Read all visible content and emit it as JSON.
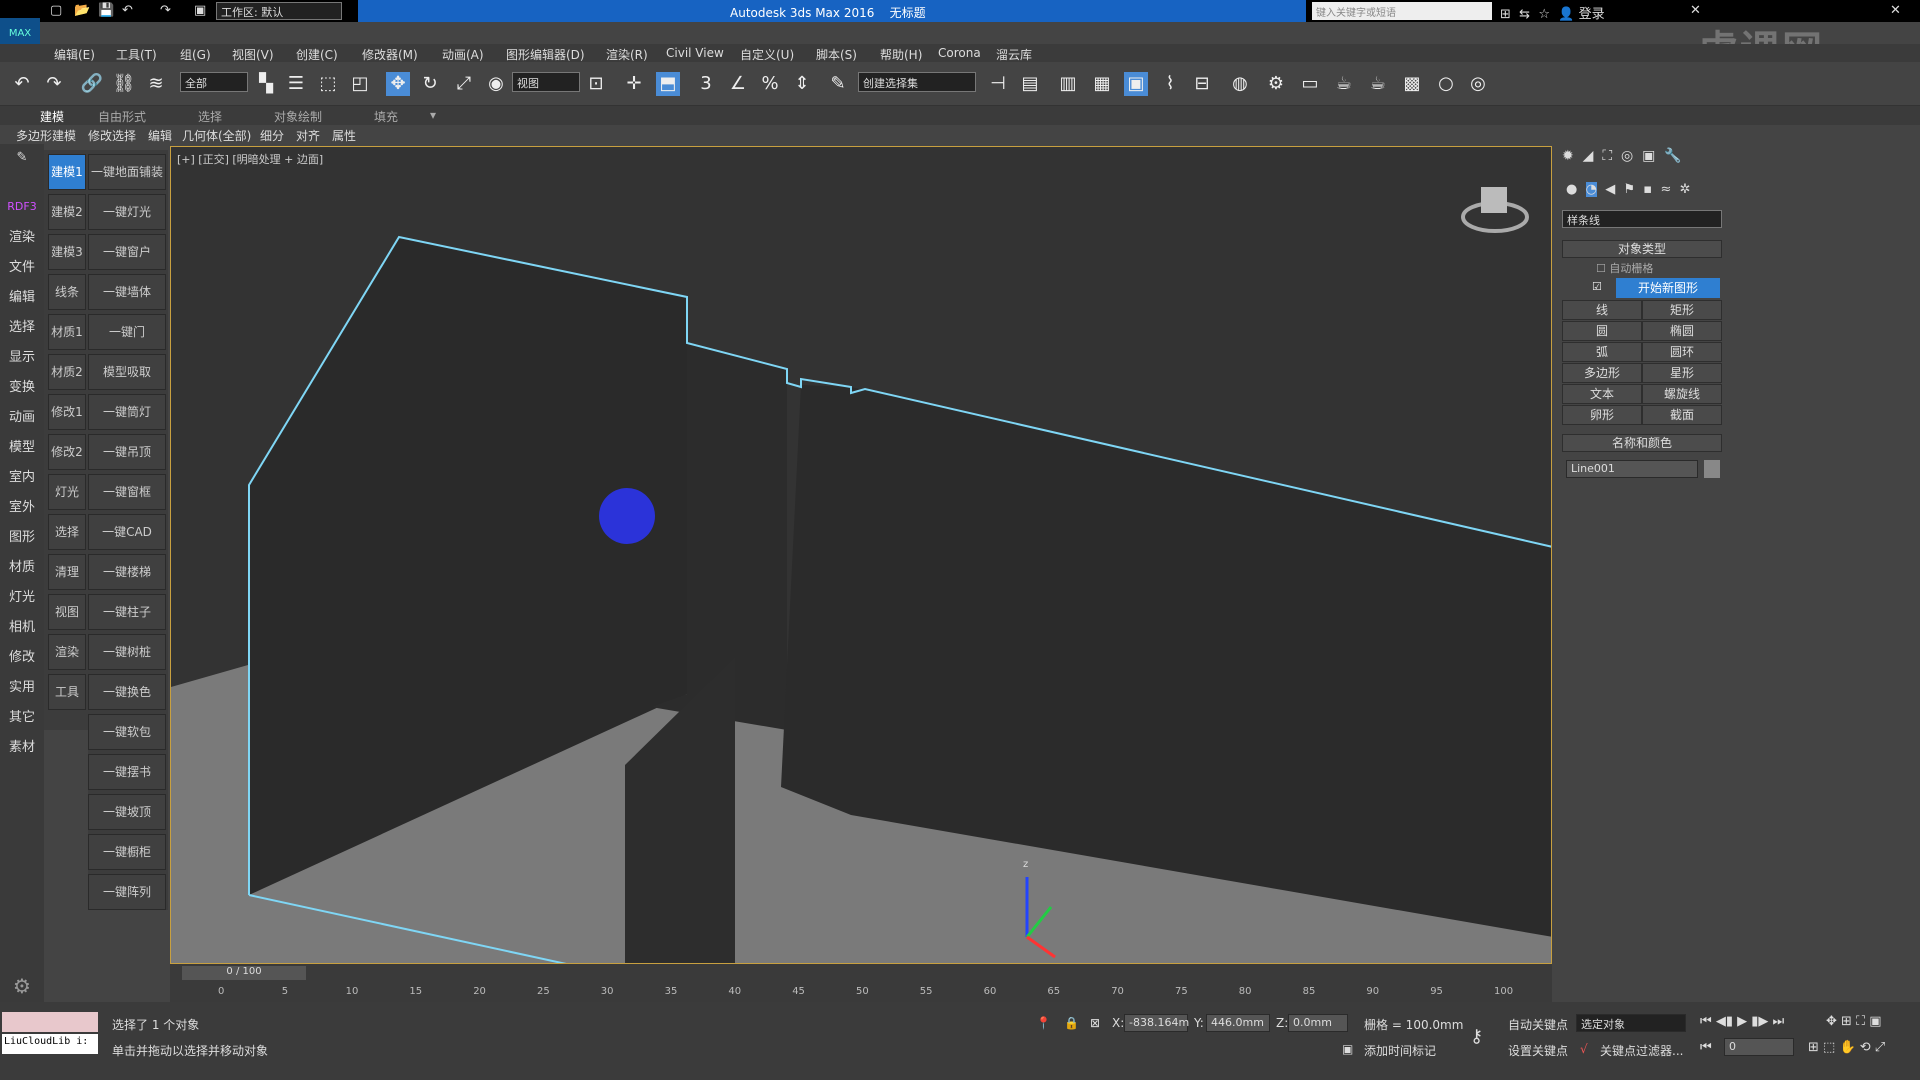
{
  "app": {
    "title": "Autodesk 3ds Max 2016",
    "doc_title": "无标题",
    "logo": "MAX",
    "workspace": "工作区: 默认",
    "search_placeholder": "键入关键字或短语",
    "login": "登录",
    "watermark": "虎课网"
  },
  "menu": [
    "编辑(E)",
    "工具(T)",
    "组(G)",
    "视图(V)",
    "创建(C)",
    "修改器(M)",
    "动画(A)",
    "图形编辑器(D)",
    "渲染(R)",
    "Civil View",
    "自定义(U)",
    "脚本(S)",
    "帮助(H)",
    "Corona",
    "溜云库"
  ],
  "toolbar": {
    "filter": "全部",
    "ref_coord": "视图",
    "selection_set": "创建选择集"
  },
  "ribbon_tabs": [
    "建模",
    "自由形式",
    "选择",
    "对象绘制",
    "填充"
  ],
  "ribbon_sub": [
    "多边形建模",
    "修改选择",
    "编辑",
    "几何体(全部)",
    "细分",
    "对齐",
    "属性"
  ],
  "left_col1": [
    "RDF3",
    "渲染",
    "文件",
    "编辑",
    "选择",
    "显示",
    "变换",
    "动画",
    "模型",
    "室内",
    "室外",
    "图形",
    "材质",
    "灯光",
    "相机",
    "修改",
    "实用",
    "其它",
    "素材"
  ],
  "left_col2": [
    "建模1",
    "建模2",
    "建模3",
    "线条",
    "材质1",
    "材质2",
    "修改1",
    "修改2",
    "灯光",
    "选择",
    "清理",
    "视图",
    "渲染",
    "工具"
  ],
  "left_col3": [
    "一键地面铺装",
    "一键灯光",
    "一键窗户",
    "一键墙体",
    "一键门",
    "模型吸取",
    "一键筒灯",
    "一键吊顶",
    "一键窗框",
    "一键CAD",
    "一键楼梯",
    "一键柱子",
    "一键树桩",
    "一键换色",
    "一键软包",
    "一键摆书",
    "一键坡顶",
    "一键橱柜",
    "一键阵列"
  ],
  "viewport": {
    "label": "[+] [正交] [明暗处理 + 边面]",
    "axis_z": "z"
  },
  "cmd": {
    "dropdown": "样条线",
    "rollout1": "对象类型",
    "auto_grid": "自动栅格",
    "start_new_shape": "开始新图形",
    "shapes": [
      [
        "线",
        "矩形"
      ],
      [
        "圆",
        "椭圆"
      ],
      [
        "弧",
        "圆环"
      ],
      [
        "多边形",
        "星形"
      ],
      [
        "文本",
        "螺旋线"
      ],
      [
        "卵形",
        "截面"
      ]
    ],
    "rollout2": "名称和颜色",
    "name": "Line001"
  },
  "timeline": {
    "frame": "0 / 100",
    "ticks": [
      "0",
      "5",
      "10",
      "15",
      "20",
      "25",
      "30",
      "35",
      "40",
      "45",
      "50",
      "55",
      "60",
      "65",
      "70",
      "75",
      "80",
      "85",
      "90",
      "95",
      "100"
    ]
  },
  "status": {
    "script_box": "LiuCloudLib i:",
    "selected": "选择了 1 个对象",
    "hint": "单击并拖动以选择并移动对象",
    "x_label": "X:",
    "x": "-838.164m",
    "y_label": "Y:",
    "y": "446.0mm",
    "z_label": "Z:",
    "z": "0.0mm",
    "grid": "栅格 = 100.0mm",
    "add_time_tag": "添加时间标记",
    "auto_key": "自动关键点",
    "set_key": "设置关键点",
    "key_mode": "选定对象",
    "key_filters": "关键点过滤器...",
    "frame_field": "0"
  }
}
